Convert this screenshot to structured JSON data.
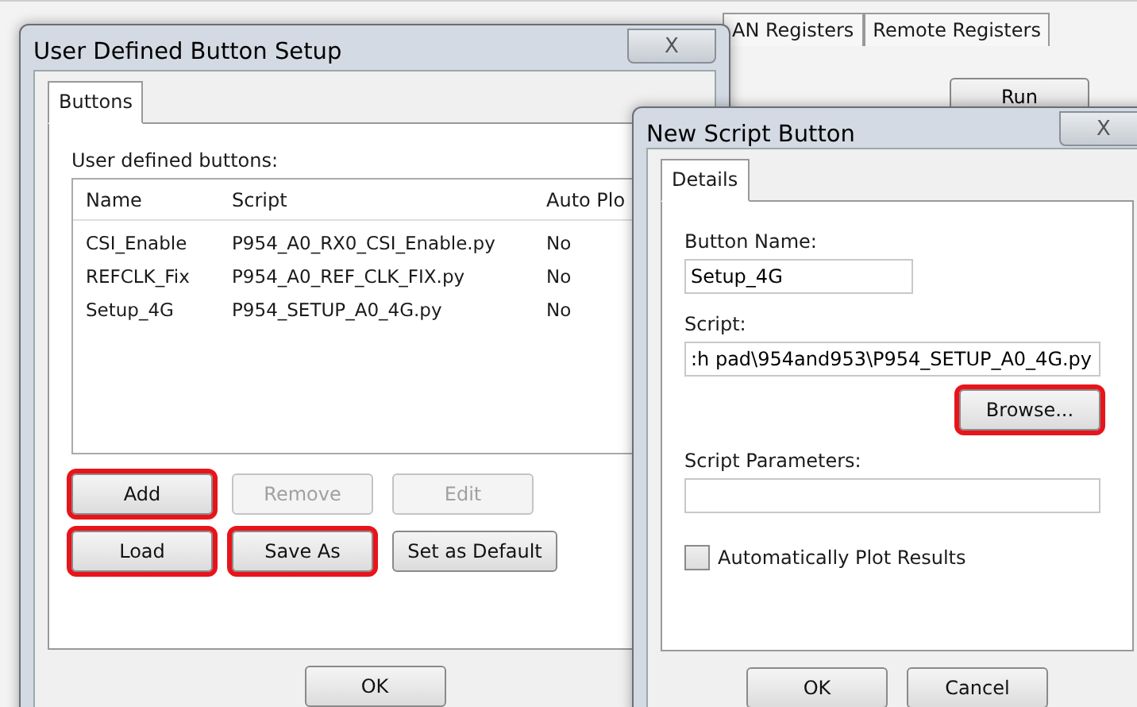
{
  "background_window": {
    "tabs": [
      "AN Registers",
      "Remote Registers"
    ],
    "run_button": "Run"
  },
  "setup_dialog": {
    "title": "User Defined Button Setup",
    "close": "X",
    "tabs": [
      {
        "label": "Buttons",
        "selected": true
      }
    ],
    "list_label": "User defined buttons:",
    "table": {
      "columns": [
        "Name",
        "Script",
        "Auto Plo"
      ],
      "rows": [
        {
          "cells": [
            "CSI_Enable",
            "P954_A0_RX0_CSI_Enable.py",
            "No"
          ]
        },
        {
          "cells": [
            "REFCLK_Fix",
            "P954_A0_REF_CLK_FIX.py",
            "No"
          ]
        },
        {
          "cells": [
            "Setup_4G",
            "P954_SETUP_A0_4G.py",
            "No"
          ]
        }
      ]
    },
    "button_rows": [
      [
        {
          "label": "Add",
          "disabled": false,
          "highlighted": true
        },
        {
          "label": "Remove",
          "disabled": true,
          "highlighted": false
        },
        {
          "label": "Edit",
          "disabled": true,
          "highlighted": false
        }
      ],
      [
        {
          "label": "Load",
          "disabled": false,
          "highlighted": true
        },
        {
          "label": "Save As",
          "disabled": false,
          "highlighted": true
        },
        {
          "label": "Set as Default",
          "disabled": false,
          "highlighted": false
        }
      ]
    ],
    "ok": "OK"
  },
  "script_dialog": {
    "title": "New Script Button",
    "close": "X",
    "tabs": [
      {
        "label": "Details",
        "selected": true
      }
    ],
    "fields": [
      {
        "label": "Button Name:",
        "value": "Setup_4G",
        "kind": "short"
      },
      {
        "label": "Script:",
        "value": ":h pad\\954and953\\P954_SETUP_A0_4G.py",
        "kind": "wide"
      }
    ],
    "browse": {
      "label": "Browse...",
      "highlighted": true
    },
    "params": {
      "label": "Script Parameters:"
    },
    "checkbox": {
      "label": "Automatically Plot Results",
      "checked": false
    },
    "buttons": [
      "OK",
      "Cancel"
    ]
  }
}
